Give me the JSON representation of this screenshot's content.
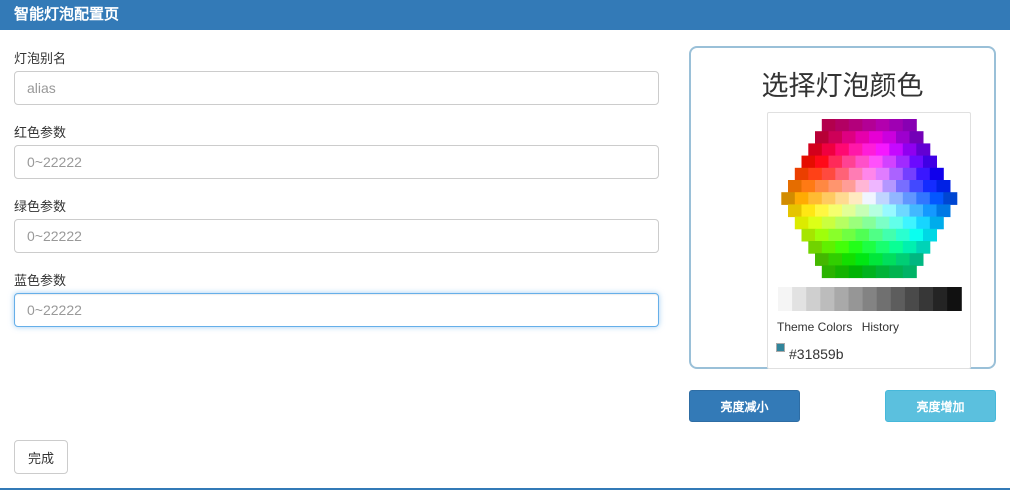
{
  "header": {
    "title": "智能灯泡配置页"
  },
  "form": {
    "alias_label": "灯泡别名",
    "alias_placeholder": "alias",
    "red_label": "红色参数",
    "red_placeholder": "0~22222",
    "green_label": "绿色参数",
    "green_placeholder": "0~22222",
    "blue_label": "蓝色参数",
    "blue_placeholder": "0~22222",
    "done_label": "完成"
  },
  "picker": {
    "title": "选择灯泡颜色",
    "tab_theme": "Theme Colors",
    "tab_history": "History",
    "selected_hex": "#31859b",
    "selected_color": "#31859b"
  },
  "controls": {
    "decrease_label": "亮度减小",
    "increase_label": "亮度增加"
  },
  "colors": {
    "header_bg": "#337ab7",
    "primary_button": "#337ab7",
    "info_button": "#5bc0de"
  }
}
